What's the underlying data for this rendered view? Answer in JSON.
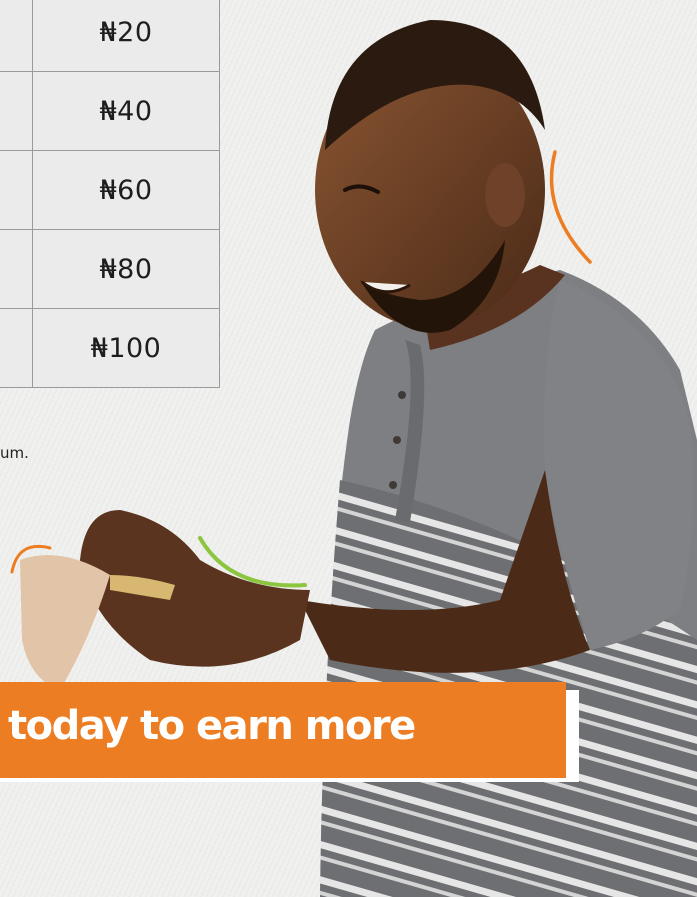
{
  "rate_table": {
    "rows": [
      {
        "amount": "₦20"
      },
      {
        "amount": "₦40"
      },
      {
        "amount": "₦60"
      },
      {
        "amount": "₦80"
      },
      {
        "amount": "₦100"
      }
    ]
  },
  "footnote": "um.",
  "banner": {
    "text": "today to earn more"
  },
  "colors": {
    "accent": "#ec7d22",
    "accent_green": "#8cc63f",
    "background": "#f1f1f0"
  },
  "image": {
    "subject": "smiling-man-counting-cash"
  }
}
